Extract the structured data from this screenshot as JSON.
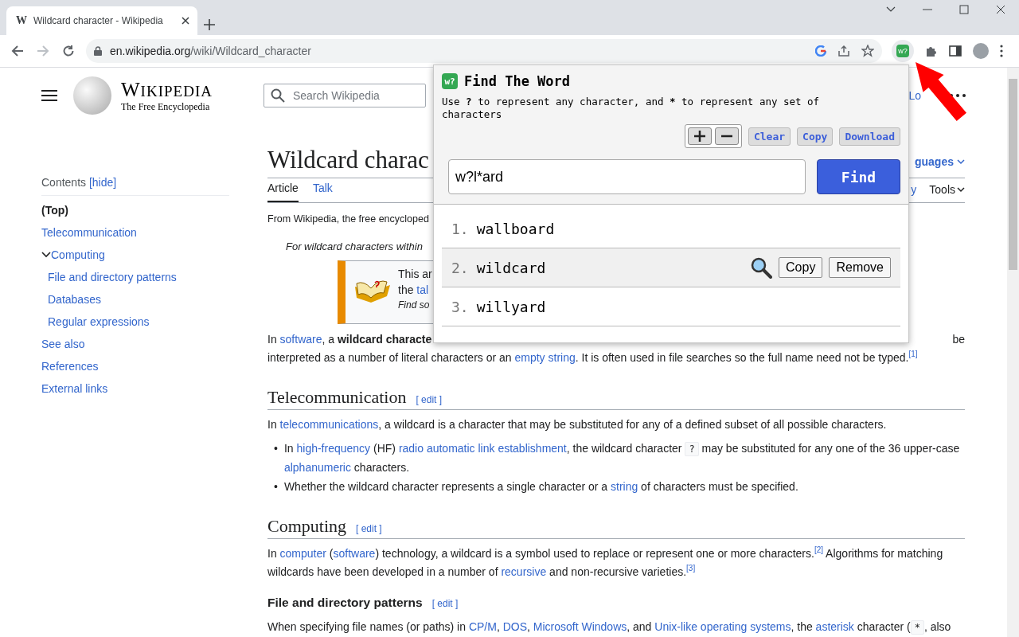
{
  "browser": {
    "favicon_letter": "W",
    "extension_badge": "w?",
    "tab_title": "Wildcard character - Wikipedia",
    "url_host": "en.wikipedia.org",
    "url_path": "/wiki/Wildcard_character"
  },
  "wiki_header": {
    "wordmark": "WIKIPEDIA",
    "tagline": "The Free Encyclopedia",
    "search_placeholder": "Search Wikipedia",
    "login": "Lo"
  },
  "toc": {
    "title": "Contents",
    "hide": "[hide]",
    "items": [
      {
        "label": "(Top)",
        "selected": true
      },
      {
        "label": "Telecommunication",
        "selected": false
      },
      {
        "label": "Computing",
        "selected": false,
        "expanded": true,
        "children": [
          {
            "label": "File and directory patterns",
            "selected": false
          },
          {
            "label": "Databases",
            "selected": false
          },
          {
            "label": "Regular expressions",
            "selected": false
          }
        ]
      },
      {
        "label": "See also",
        "selected": false
      },
      {
        "label": "References",
        "selected": false
      },
      {
        "label": "External links",
        "selected": false
      }
    ]
  },
  "article": {
    "title": "Wildcard charac",
    "languages": "guages",
    "tabs": [
      {
        "label": "Article",
        "selected": true
      },
      {
        "label": "Talk",
        "selected": false
      }
    ],
    "history": "y",
    "tools": "Tools",
    "tagline": "From Wikipedia, the free encycloped",
    "hatnote": "For wildcard characters within",
    "notice": {
      "line_1": "This ar",
      "line_2_text": "the ",
      "line_2_link": "tal",
      "line_3": "Find so"
    },
    "intro": {
      "line_1": [
        {
          "kind": "text",
          "text": "In "
        },
        {
          "kind": "link",
          "text": "software"
        },
        {
          "kind": "text",
          "text": ", a "
        },
        {
          "kind": "bold",
          "text": "wildcard characte"
        }
      ],
      "line_1_end": "be",
      "line_2": [
        {
          "kind": "text",
          "text": "interpreted as a number of literal characters or an "
        },
        {
          "kind": "link",
          "text": "empty string"
        },
        {
          "kind": "text",
          "text": ". It is often used in file searches so the full name need not be typed."
        },
        {
          "kind": "sup",
          "text": "[1]"
        }
      ]
    },
    "sections": [
      {
        "kind": "h2",
        "heading": "Telecommunication",
        "edit": "[ edit ]",
        "paragraph": [
          {
            "kind": "text",
            "text": "In "
          },
          {
            "kind": "link",
            "text": "telecommunications"
          },
          {
            "kind": "text",
            "text": ", a wildcard is a character that may be substituted for any of a defined subset of all possible characters."
          }
        ],
        "bullets": [
          {
            "marker": "•",
            "segments": [
              {
                "kind": "text",
                "text": "In "
              },
              {
                "kind": "link",
                "text": "high-frequency"
              },
              {
                "kind": "text",
                "text": " (HF) "
              },
              {
                "kind": "link",
                "text": "radio automatic link establishment"
              },
              {
                "kind": "text",
                "text": ", the wildcard character "
              },
              {
                "kind": "code",
                "text": "?"
              },
              {
                "kind": "text",
                "text": " may be substituted for any one of the 36 upper-case "
              },
              {
                "kind": "link",
                "text": "alphanumeric"
              },
              {
                "kind": "text",
                "text": " characters."
              }
            ]
          },
          {
            "marker": "•",
            "segments": [
              {
                "kind": "text",
                "text": "Whether the wildcard character represents a single character or a "
              },
              {
                "kind": "link",
                "text": "string"
              },
              {
                "kind": "text",
                "text": " of characters must be specified."
              }
            ]
          }
        ]
      },
      {
        "kind": "h2",
        "heading": "Computing",
        "edit": "[ edit ]",
        "paragraph": [
          {
            "kind": "text",
            "text": "In "
          },
          {
            "kind": "link",
            "text": "computer"
          },
          {
            "kind": "text",
            "text": " ("
          },
          {
            "kind": "link",
            "text": "software"
          },
          {
            "kind": "text",
            "text": ") technology, a wildcard is a symbol used to replace or represent one or more characters."
          },
          {
            "kind": "sup",
            "text": "[2]"
          },
          {
            "kind": "text",
            "text": " Algorithms for matching wildcards have been developed in a number of "
          },
          {
            "kind": "link",
            "text": "recursive"
          },
          {
            "kind": "text",
            "text": " and non-recursive varieties."
          },
          {
            "kind": "sup",
            "text": "[3]"
          }
        ]
      },
      {
        "kind": "h3",
        "heading": "File and directory patterns",
        "edit": "[ edit ]",
        "paragraph": [
          {
            "kind": "text",
            "text": "When specifying file names (or paths) in "
          },
          {
            "kind": "link",
            "text": "CP/M"
          },
          {
            "kind": "text",
            "text": ", "
          },
          {
            "kind": "link",
            "text": "DOS"
          },
          {
            "kind": "text",
            "text": ", "
          },
          {
            "kind": "link",
            "text": "Microsoft Windows"
          },
          {
            "kind": "text",
            "text": ", and "
          },
          {
            "kind": "link",
            "text": "Unix-like operating systems"
          },
          {
            "kind": "text",
            "text": ", the "
          },
          {
            "kind": "link",
            "text": "asterisk"
          },
          {
            "kind": "text",
            "text": " character ("
          },
          {
            "kind": "code",
            "text": "*"
          },
          {
            "kind": "text",
            "text": ", also"
          }
        ]
      }
    ]
  },
  "extension_popup": {
    "badge": "w?",
    "title": "Find The Word",
    "description": [
      {
        "kind": "text",
        "text": "Use "
      },
      {
        "kind": "bold",
        "text": "?"
      },
      {
        "kind": "text",
        "text": " to represent any character, and "
      },
      {
        "kind": "bold",
        "text": "*"
      },
      {
        "kind": "text",
        "text": " to represent any set of characters"
      }
    ],
    "tools": [
      "Clear",
      "Copy",
      "Download"
    ],
    "query": "w?l*ard",
    "find_label": "Find",
    "results": [
      {
        "number": "1.",
        "word": "wallboard",
        "hovered": false
      },
      {
        "number": "2.",
        "word": "wildcard",
        "hovered": true
      },
      {
        "number": "3.",
        "word": "willyard",
        "hovered": false
      }
    ],
    "row_actions": [
      "Copy",
      "Remove"
    ]
  }
}
